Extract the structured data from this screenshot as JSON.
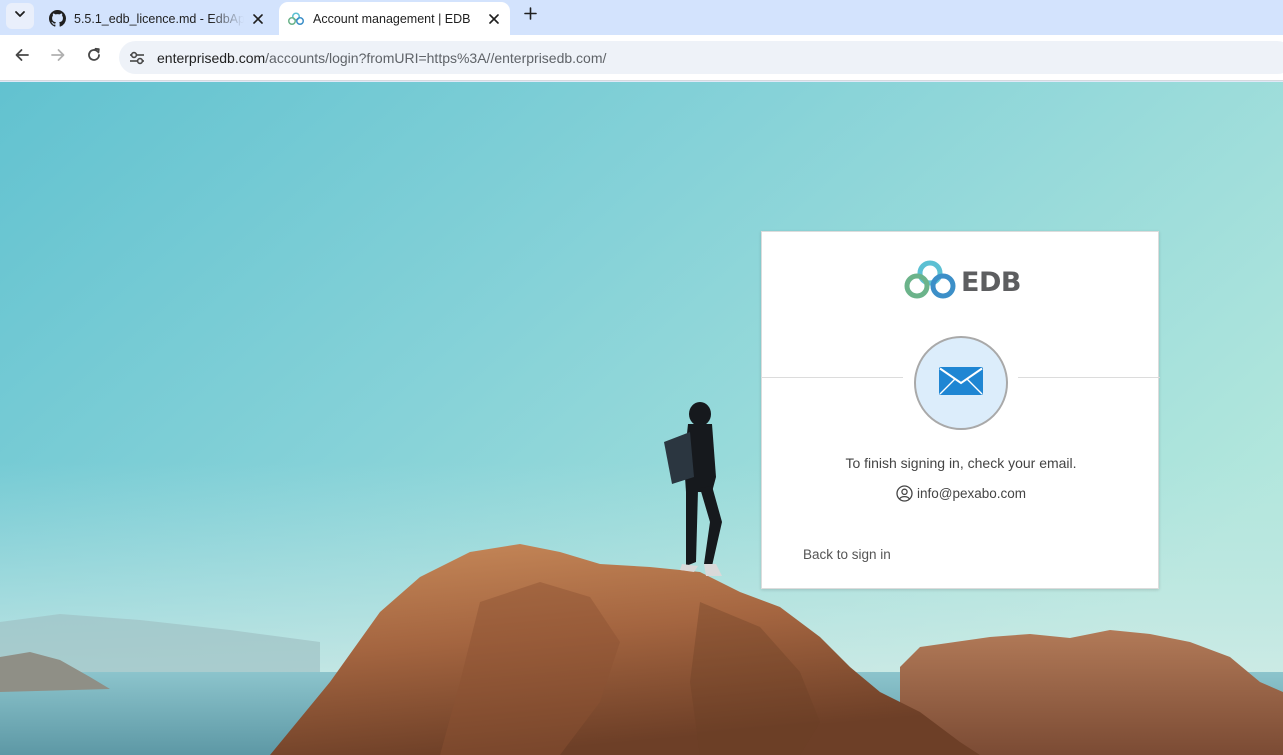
{
  "browser": {
    "tabs": [
      {
        "title": "5.5.1_edb_licence.md - EdbApa",
        "favicon": "github-icon",
        "active": false
      },
      {
        "title": "Account management | EDB",
        "favicon": "edb-icon",
        "active": true
      }
    ],
    "address": {
      "host": "enterprisedb.com",
      "path": "/accounts/login?fromURI=https%3A//enterprisedb.com/"
    }
  },
  "card": {
    "logo_text": "EDB",
    "message": "To finish signing in, check your email.",
    "email": "info@pexabo.com",
    "back_link": "Back to sign in"
  },
  "colors": {
    "accent_blue": "#1a73e8",
    "mail_icon": "#1f86d3",
    "logo_teal": "#5cc0d3",
    "logo_green": "#6bb38a"
  }
}
